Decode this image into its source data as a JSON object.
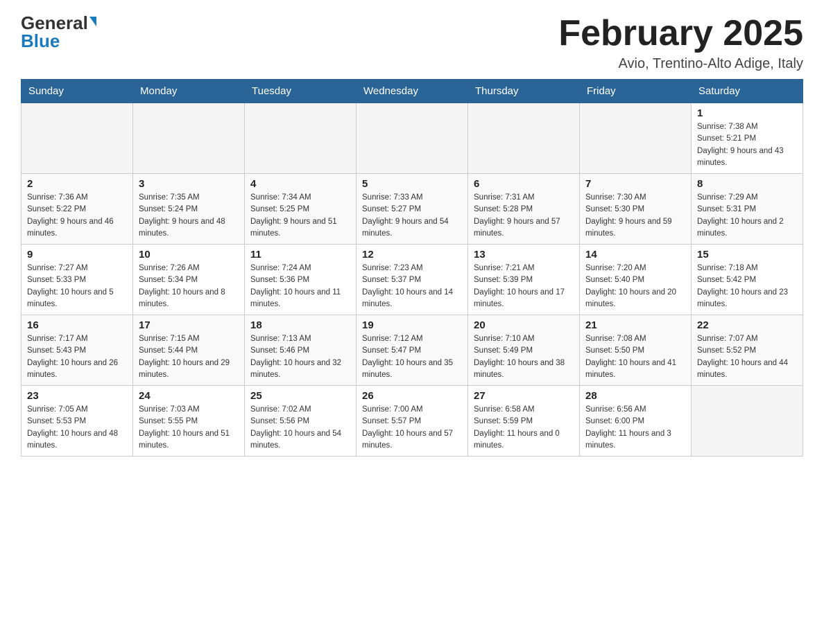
{
  "header": {
    "logo_general": "General",
    "logo_blue": "Blue",
    "month_title": "February 2025",
    "location": "Avio, Trentino-Alto Adige, Italy"
  },
  "days_of_week": [
    "Sunday",
    "Monday",
    "Tuesday",
    "Wednesday",
    "Thursday",
    "Friday",
    "Saturday"
  ],
  "weeks": [
    {
      "days": [
        {
          "num": "",
          "info": ""
        },
        {
          "num": "",
          "info": ""
        },
        {
          "num": "",
          "info": ""
        },
        {
          "num": "",
          "info": ""
        },
        {
          "num": "",
          "info": ""
        },
        {
          "num": "",
          "info": ""
        },
        {
          "num": "1",
          "info": "Sunrise: 7:38 AM\nSunset: 5:21 PM\nDaylight: 9 hours and 43 minutes."
        }
      ]
    },
    {
      "days": [
        {
          "num": "2",
          "info": "Sunrise: 7:36 AM\nSunset: 5:22 PM\nDaylight: 9 hours and 46 minutes."
        },
        {
          "num": "3",
          "info": "Sunrise: 7:35 AM\nSunset: 5:24 PM\nDaylight: 9 hours and 48 minutes."
        },
        {
          "num": "4",
          "info": "Sunrise: 7:34 AM\nSunset: 5:25 PM\nDaylight: 9 hours and 51 minutes."
        },
        {
          "num": "5",
          "info": "Sunrise: 7:33 AM\nSunset: 5:27 PM\nDaylight: 9 hours and 54 minutes."
        },
        {
          "num": "6",
          "info": "Sunrise: 7:31 AM\nSunset: 5:28 PM\nDaylight: 9 hours and 57 minutes."
        },
        {
          "num": "7",
          "info": "Sunrise: 7:30 AM\nSunset: 5:30 PM\nDaylight: 9 hours and 59 minutes."
        },
        {
          "num": "8",
          "info": "Sunrise: 7:29 AM\nSunset: 5:31 PM\nDaylight: 10 hours and 2 minutes."
        }
      ]
    },
    {
      "days": [
        {
          "num": "9",
          "info": "Sunrise: 7:27 AM\nSunset: 5:33 PM\nDaylight: 10 hours and 5 minutes."
        },
        {
          "num": "10",
          "info": "Sunrise: 7:26 AM\nSunset: 5:34 PM\nDaylight: 10 hours and 8 minutes."
        },
        {
          "num": "11",
          "info": "Sunrise: 7:24 AM\nSunset: 5:36 PM\nDaylight: 10 hours and 11 minutes."
        },
        {
          "num": "12",
          "info": "Sunrise: 7:23 AM\nSunset: 5:37 PM\nDaylight: 10 hours and 14 minutes."
        },
        {
          "num": "13",
          "info": "Sunrise: 7:21 AM\nSunset: 5:39 PM\nDaylight: 10 hours and 17 minutes."
        },
        {
          "num": "14",
          "info": "Sunrise: 7:20 AM\nSunset: 5:40 PM\nDaylight: 10 hours and 20 minutes."
        },
        {
          "num": "15",
          "info": "Sunrise: 7:18 AM\nSunset: 5:42 PM\nDaylight: 10 hours and 23 minutes."
        }
      ]
    },
    {
      "days": [
        {
          "num": "16",
          "info": "Sunrise: 7:17 AM\nSunset: 5:43 PM\nDaylight: 10 hours and 26 minutes."
        },
        {
          "num": "17",
          "info": "Sunrise: 7:15 AM\nSunset: 5:44 PM\nDaylight: 10 hours and 29 minutes."
        },
        {
          "num": "18",
          "info": "Sunrise: 7:13 AM\nSunset: 5:46 PM\nDaylight: 10 hours and 32 minutes."
        },
        {
          "num": "19",
          "info": "Sunrise: 7:12 AM\nSunset: 5:47 PM\nDaylight: 10 hours and 35 minutes."
        },
        {
          "num": "20",
          "info": "Sunrise: 7:10 AM\nSunset: 5:49 PM\nDaylight: 10 hours and 38 minutes."
        },
        {
          "num": "21",
          "info": "Sunrise: 7:08 AM\nSunset: 5:50 PM\nDaylight: 10 hours and 41 minutes."
        },
        {
          "num": "22",
          "info": "Sunrise: 7:07 AM\nSunset: 5:52 PM\nDaylight: 10 hours and 44 minutes."
        }
      ]
    },
    {
      "days": [
        {
          "num": "23",
          "info": "Sunrise: 7:05 AM\nSunset: 5:53 PM\nDaylight: 10 hours and 48 minutes."
        },
        {
          "num": "24",
          "info": "Sunrise: 7:03 AM\nSunset: 5:55 PM\nDaylight: 10 hours and 51 minutes."
        },
        {
          "num": "25",
          "info": "Sunrise: 7:02 AM\nSunset: 5:56 PM\nDaylight: 10 hours and 54 minutes."
        },
        {
          "num": "26",
          "info": "Sunrise: 7:00 AM\nSunset: 5:57 PM\nDaylight: 10 hours and 57 minutes."
        },
        {
          "num": "27",
          "info": "Sunrise: 6:58 AM\nSunset: 5:59 PM\nDaylight: 11 hours and 0 minutes."
        },
        {
          "num": "28",
          "info": "Sunrise: 6:56 AM\nSunset: 6:00 PM\nDaylight: 11 hours and 3 minutes."
        },
        {
          "num": "",
          "info": ""
        }
      ]
    }
  ]
}
